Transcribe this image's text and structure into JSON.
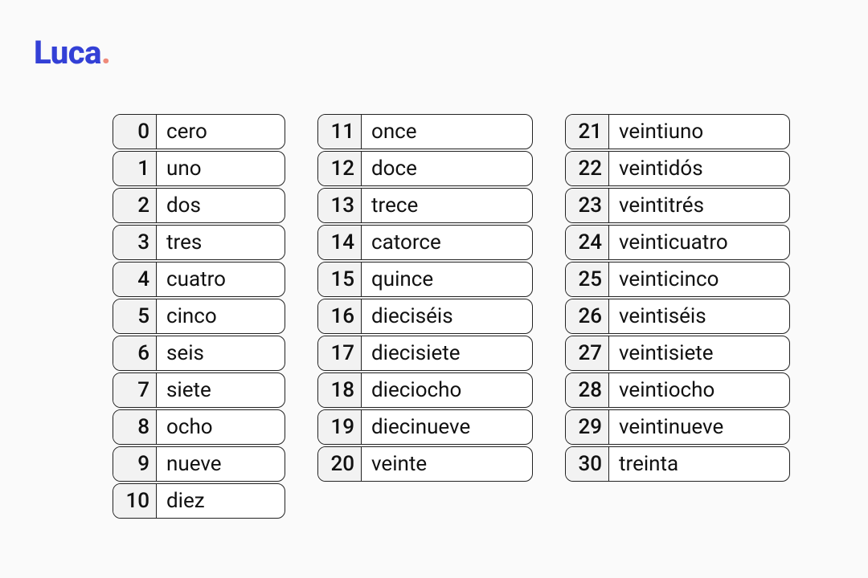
{
  "logo": {
    "text": "Luca",
    "dot": "."
  },
  "columns": [
    {
      "rows": [
        {
          "num": "0",
          "word": "cero"
        },
        {
          "num": "1",
          "word": "uno"
        },
        {
          "num": "2",
          "word": "dos"
        },
        {
          "num": "3",
          "word": "tres"
        },
        {
          "num": "4",
          "word": "cuatro"
        },
        {
          "num": "5",
          "word": "cinco"
        },
        {
          "num": "6",
          "word": "seis"
        },
        {
          "num": "7",
          "word": "siete"
        },
        {
          "num": "8",
          "word": "ocho"
        },
        {
          "num": "9",
          "word": "nueve"
        },
        {
          "num": "10",
          "word": "diez"
        }
      ]
    },
    {
      "rows": [
        {
          "num": "11",
          "word": "once"
        },
        {
          "num": "12",
          "word": "doce"
        },
        {
          "num": "13",
          "word": "trece"
        },
        {
          "num": "14",
          "word": "catorce"
        },
        {
          "num": "15",
          "word": "quince"
        },
        {
          "num": "16",
          "word": "dieciséis"
        },
        {
          "num": "17",
          "word": "diecisiete"
        },
        {
          "num": "18",
          "word": "dieciocho"
        },
        {
          "num": "19",
          "word": "diecinueve"
        },
        {
          "num": "20",
          "word": "veinte"
        }
      ]
    },
    {
      "rows": [
        {
          "num": "21",
          "word": "veintiuno"
        },
        {
          "num": "22",
          "word": "veintidós"
        },
        {
          "num": "23",
          "word": "veintitrés"
        },
        {
          "num": "24",
          "word": "veinticuatro"
        },
        {
          "num": "25",
          "word": "veinticinco"
        },
        {
          "num": "26",
          "word": "veintiséis"
        },
        {
          "num": "27",
          "word": "veintisiete"
        },
        {
          "num": "28",
          "word": "veintiocho"
        },
        {
          "num": "29",
          "word": "veintinueve"
        },
        {
          "num": "30",
          "word": "treinta"
        }
      ]
    }
  ]
}
